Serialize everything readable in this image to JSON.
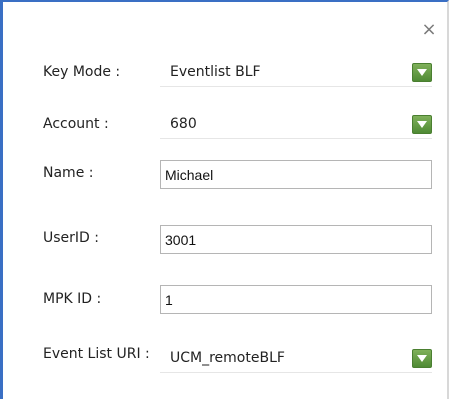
{
  "dialog": {
    "close_glyph": "×",
    "close_icon": "close-icon"
  },
  "fields": {
    "key_mode": {
      "label": "Key Mode :",
      "value": "Eventlist BLF",
      "dropdown_icon": "chevron-down-icon"
    },
    "account": {
      "label": "Account :",
      "value": "680",
      "dropdown_icon": "chevron-down-icon"
    },
    "name": {
      "label": "Name :",
      "value": "Michael"
    },
    "userid": {
      "label": "UserID :",
      "value": "3001"
    },
    "mpk_id": {
      "label": "MPK ID :",
      "value": "1"
    },
    "event_list_uri": {
      "label": "Event List URI :",
      "value": "UCM_remoteBLF",
      "dropdown_icon": "chevron-down-icon"
    }
  },
  "colors": {
    "border_accent": "#3a6fc4",
    "dropdown_button": "#5f9a3e"
  }
}
